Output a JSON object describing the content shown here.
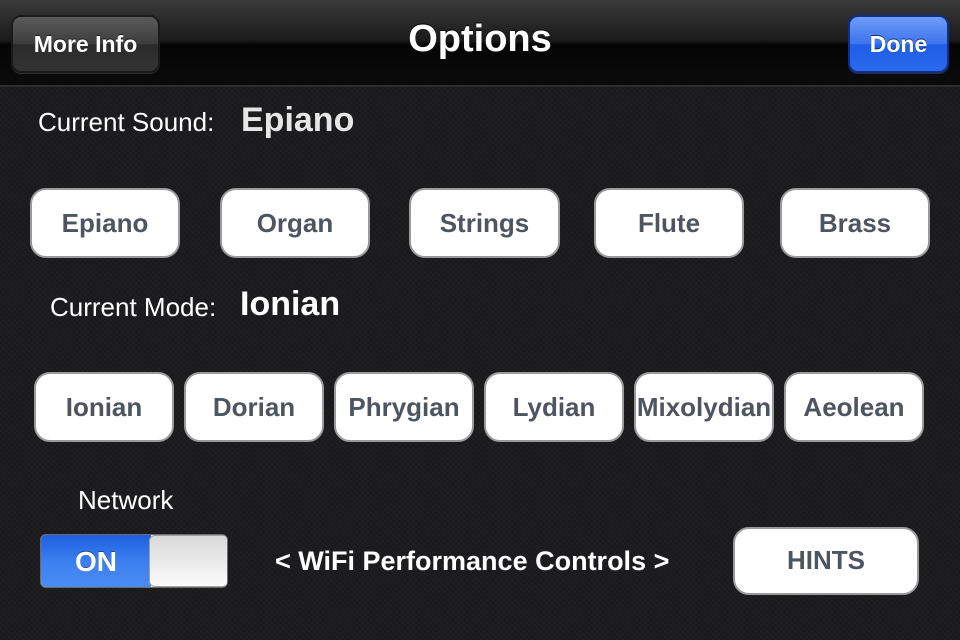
{
  "nav": {
    "title": "Options",
    "more_info_label": "More Info",
    "done_label": "Done"
  },
  "sound": {
    "label": "Current Sound:",
    "current": "Epiano",
    "options": [
      "Epiano",
      "Organ",
      "Strings",
      "Flute",
      "Brass"
    ]
  },
  "mode": {
    "label": "Current Mode:",
    "current": "Ionian",
    "options": [
      "Ionian",
      "Dorian",
      "Phrygian",
      "Lydian",
      "Mixolydian",
      "Aeolean"
    ]
  },
  "network": {
    "label": "Network",
    "toggle_state": "ON",
    "wifi_controls_label": "< WiFi Performance Controls >",
    "hints_label": "HINTS"
  },
  "colors": {
    "done_button": "#2a68ec",
    "toggle_on": "#3b7ff0",
    "background": "#1c1c1e"
  }
}
